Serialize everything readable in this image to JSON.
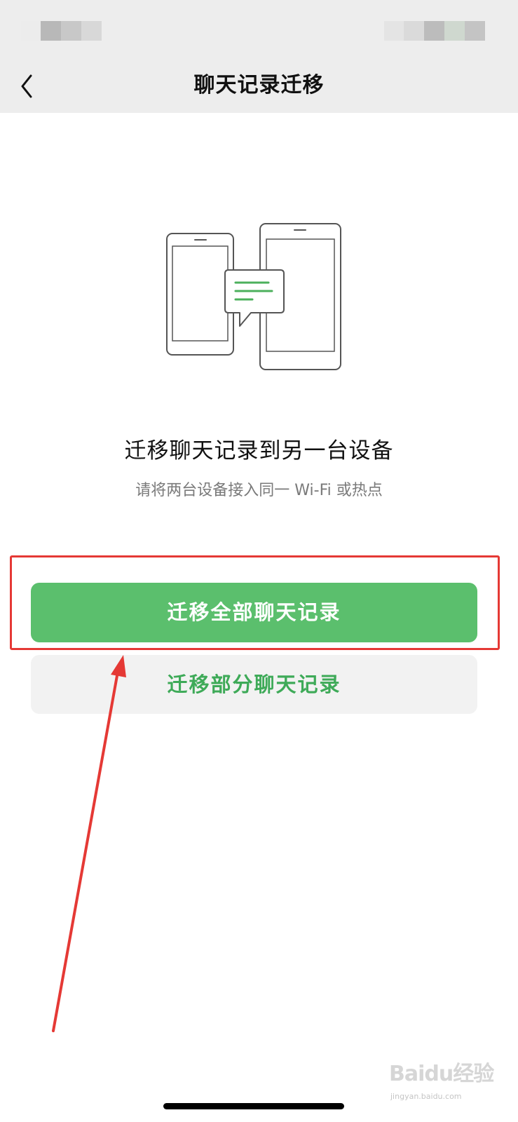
{
  "nav": {
    "title": "聊天记录迁移",
    "back_icon": "chevron-left-icon"
  },
  "main": {
    "illustration": "two-phones-transfer-icon",
    "heading": "迁移聊天记录到另一台设备",
    "subtext": "请将两台设备接入同一 Wi-Fi 或热点"
  },
  "actions": {
    "migrate_all_label": "迁移全部聊天记录",
    "migrate_partial_label": "迁移部分聊天记录"
  },
  "watermark": {
    "logo": "Baidu经验",
    "url": "jingyan.baidu.com"
  },
  "colors": {
    "primary_green": "#5bbf6d",
    "secondary_text_green": "#3eaa58",
    "annotation_red": "#e53935",
    "nav_background": "#ededed"
  }
}
